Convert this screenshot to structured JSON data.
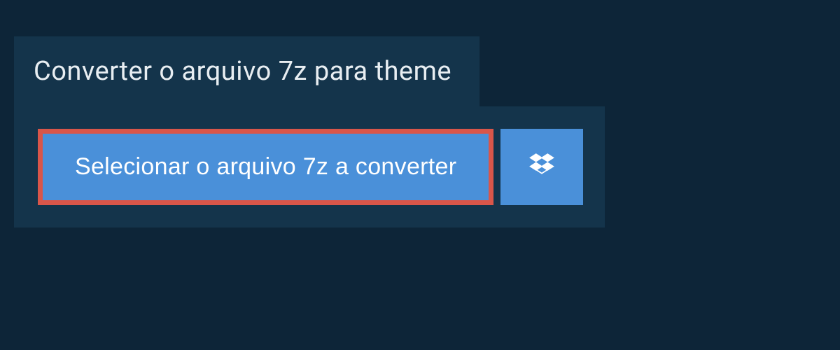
{
  "header": {
    "title": "Converter o arquivo 7z para theme"
  },
  "actions": {
    "select_file_label": "Selecionar o arquivo 7z a converter"
  }
}
